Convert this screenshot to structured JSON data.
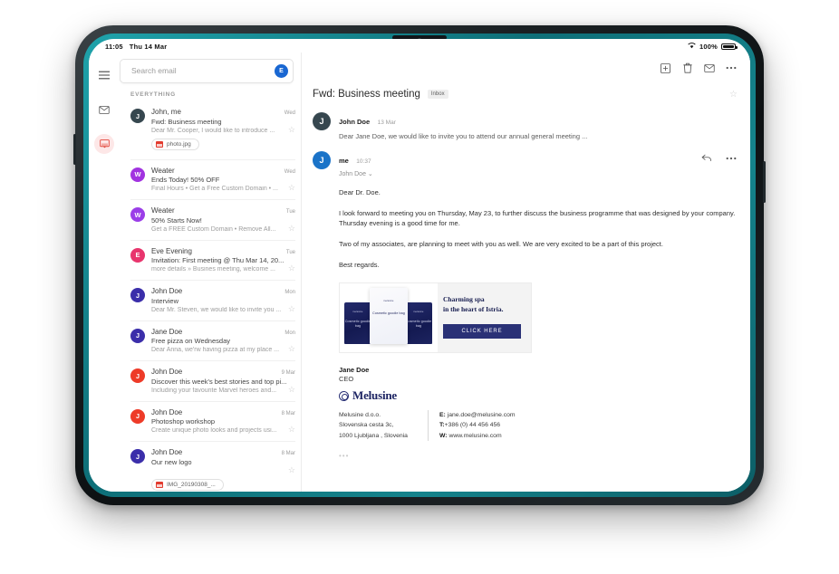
{
  "status_bar": {
    "time": "11:05",
    "date": "Thu 14 Mar",
    "wifi_icon": "wifi-icon",
    "battery_pct": "100%"
  },
  "toolbar": {
    "menu_icon": "hamburger-menu-icon",
    "archive_icon": "archive-icon",
    "delete_icon": "trash-icon",
    "mail_icon": "envelope-icon",
    "more_icon": "more-horizontal-icon"
  },
  "rail": {
    "mail_icon": "envelope-icon",
    "chat_icon": "chat-bubble-icon"
  },
  "search": {
    "placeholder": "Search email",
    "value": "",
    "avatar_initial": "E",
    "avatar_color": "#1967d2"
  },
  "list": {
    "section_label": "EVERYTHING",
    "items": [
      {
        "initial": "J",
        "color": "#36474f",
        "from": "John, me",
        "date": "Wed",
        "subject": "Fwd: Business meeting",
        "preview": "Dear Mr. Cooper, I would like to introduce ...",
        "attachment": "photo.jpg",
        "starred": false
      },
      {
        "initial": "W",
        "color": "#a133e0",
        "from": "Weater",
        "date": "Wed",
        "subject": "Ends Today! 50% OFF",
        "preview": "Final Hours • Get a Free Custom Domain • ...",
        "attachment": null,
        "starred": false
      },
      {
        "initial": "W",
        "color": "#9b3ee8",
        "from": "Weater",
        "date": "Tue",
        "subject": "50% Starts Now!",
        "preview": "Get a FREE Custom Domain • Remove All...",
        "attachment": null,
        "starred": false
      },
      {
        "initial": "E",
        "color": "#e8356d",
        "from": "Eve Evening",
        "date": "Tue",
        "subject": "Invitation: First meeting   @ Thu Mar 14, 20...",
        "preview": "more details » Busines meeting, welcome  ...",
        "attachment": null,
        "starred": false
      },
      {
        "initial": "J",
        "color": "#3b2eaa",
        "from": "John Doe",
        "date": "Mon",
        "subject": "Interview",
        "preview": "Dear Mr. Steven, we would like to invite you ...",
        "attachment": null,
        "starred": false
      },
      {
        "initial": "J",
        "color": "#3b2eaa",
        "from": "Jane Doe",
        "date": "Mon",
        "subject": "Free pizza on Wednesday",
        "preview": "Dear Anna, we'rw having pizza at my place ...",
        "attachment": null,
        "starred": false
      },
      {
        "initial": "J",
        "color": "#ee3b28",
        "from": "John Doe",
        "date": "9 Mar",
        "subject": "Discover this week's best stories and top pi...",
        "preview": "Including your favourite Marvel heroes and...",
        "attachment": null,
        "starred": false
      },
      {
        "initial": "J",
        "color": "#ee3b28",
        "from": "John Doe",
        "date": "8 Mar",
        "subject": "Photoshop workshop",
        "preview": "Create unique photo looks and projects usi...",
        "attachment": null,
        "starred": false
      },
      {
        "initial": "J",
        "color": "#3b2eaa",
        "from": "John Doe",
        "date": "8 Mar",
        "subject": "Our new logo",
        "preview": "",
        "attachment": "IMG_20190308_...",
        "starred": false
      }
    ],
    "star_glyph": "☆"
  },
  "reader": {
    "subject": "Fwd: Business meeting",
    "label": "Inbox",
    "star_glyph": "☆",
    "collapsed_message": {
      "initial": "J",
      "color": "#36474f",
      "sender": "John Doe",
      "date": "13 Mar",
      "preview": "Dear Jane Doe, we would like to invite you to attend our annual general meeting ..."
    },
    "open_message": {
      "initial": "J",
      "color": "#1a73c8",
      "sender": "me",
      "time": "10:37",
      "recipient": "John Doe",
      "recipient_caret": "⌄",
      "reply_icon": "reply-arrow-icon",
      "more_icon": "more-horizontal-icon",
      "paragraphs": [
        "Dear Dr. Doe.",
        "I look forward to meeting you on Thursday, May 23, to further discuss the business programme that was designed by your company. Thursday evening is a good time for me.",
        "Two of my associates, are planning to meet with you as well. We are very excited to be a part of this project.",
        "Best regards."
      ]
    },
    "banner": {
      "pouch_label": "Cosmetic goodie bag",
      "pouch_brand": "melusine",
      "headline_line1": "Charming spa",
      "headline_line2": "in the heart of Istria.",
      "cta": "CLICK HERE",
      "cta_color": "#2a3176"
    },
    "signature": {
      "name": "Jane Doe",
      "role": "CEO",
      "brand": "Melusine",
      "brand_mark_icon": "melusine-logo-icon",
      "company_line1": "Melusine d.o.o.",
      "company_line2": "Slovenska cesta 3c,",
      "company_line3": "1000 Ljubljana , Slovenia",
      "email_label": "E:",
      "email": "jane.doe@melusine.com",
      "phone_label": "T:",
      "phone": "+386 (0) 44 456 456",
      "web_label": "W:",
      "web": "www.melusine.com"
    },
    "trimmed_content": "•••"
  }
}
